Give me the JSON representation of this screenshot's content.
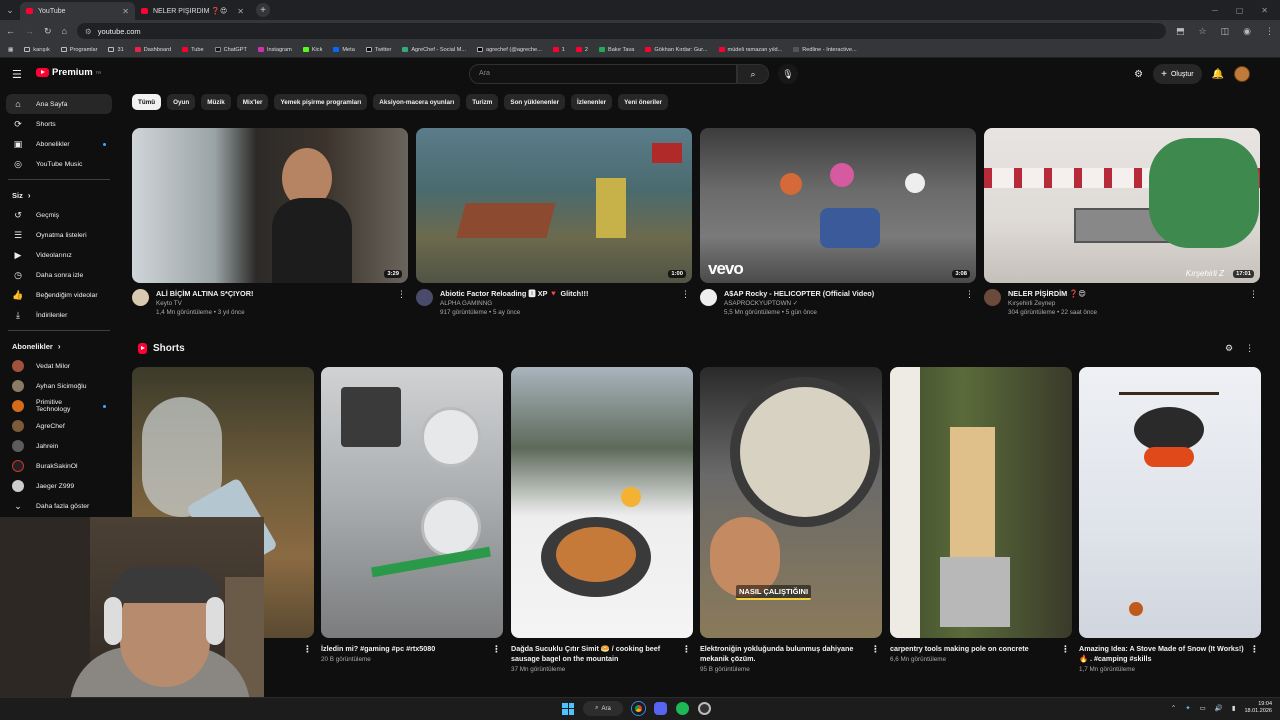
{
  "browser": {
    "tabs": [
      {
        "title": "YouTube",
        "active": true
      },
      {
        "title": "NELER PİŞİRDİM ❓😍 - YouTube",
        "active": false
      }
    ],
    "address": "youtube.com",
    "bookmarks": [
      "karışık",
      "Programlar",
      "31",
      "Dashboard",
      "Tube",
      "ChatGPT",
      "Instagram",
      "Kick",
      "Meta",
      "Twitter",
      "AgreChef - Social M...",
      "agrechef (@agreche...",
      "1",
      "2",
      "Bakır Tava",
      "Gökhan Kırdar: Gur...",
      "müdeli ramazan yıld...",
      "Redline - Interactive..."
    ]
  },
  "masthead": {
    "logo_text": "Premium",
    "logo_region": "TR",
    "search_placeholder": "Ara",
    "create_label": "Oluştur"
  },
  "sidebar": {
    "main": [
      {
        "label": "Ana Sayfa",
        "icon": "home-icon",
        "active": true
      },
      {
        "label": "Shorts",
        "icon": "shorts-icon"
      },
      {
        "label": "Abonelikler",
        "icon": "subscriptions-icon",
        "dot": true
      },
      {
        "label": "YouTube Music",
        "icon": "music-icon"
      }
    ],
    "you_heading": "Siz",
    "you": [
      {
        "label": "Geçmiş",
        "icon": "history-icon"
      },
      {
        "label": "Oynatma listeleri",
        "icon": "playlists-icon"
      },
      {
        "label": "Videolarınız",
        "icon": "your-videos-icon"
      },
      {
        "label": "Daha sonra izle",
        "icon": "watch-later-icon"
      },
      {
        "label": "Beğendiğim videolar",
        "icon": "liked-icon"
      },
      {
        "label": "İndirilenler",
        "icon": "downloads-icon"
      }
    ],
    "subs_heading": "Abonelikler",
    "subs": [
      {
        "label": "Vedat Milor",
        "color": "#a0523d"
      },
      {
        "label": "Ayhan Sicimoğlu",
        "color": "#8a7b64"
      },
      {
        "label": "Primitive Technology",
        "color": "#d46a1a",
        "dot": true
      },
      {
        "label": "AgreChef",
        "color": "#7c5a3a"
      },
      {
        "label": "Jahrein",
        "color": "#5c5c5c"
      },
      {
        "label": "BurakSakinOl",
        "color": "#222222"
      },
      {
        "label": "Jaeger Z999",
        "color": "#cccccc"
      }
    ],
    "more_label": "Daha fazla göster"
  },
  "chips": [
    "Tümü",
    "Oyun",
    "Müzik",
    "Mix'ler",
    "Yemek pişirme programları",
    "Aksiyon-macera oyunları",
    "Turizm",
    "Son yüklenenler",
    "İzlenenler",
    "Yeni öneriler"
  ],
  "videos": [
    {
      "title": "ALİ BİÇİM ALTINA S*ÇIYOR!",
      "channel": "Keyto TV",
      "stats": "1,4 Mn görüntüleme • 3 yıl önce",
      "duration": "3:29"
    },
    {
      "title": "Abiotic Factor Reloading 🆇 XP 🔻 Glitch!!!",
      "channel": "ALPHA GAMINNG",
      "stats": "917 görüntüleme • 5 ay önce",
      "duration": "1:00"
    },
    {
      "title": "A$AP Rocky - HELICOPTER (Official Video)",
      "channel": "ASAPROCKYUPTOWN ✓",
      "stats": "5,5 Mn görüntüleme • 5 gün önce",
      "duration": "3:08",
      "watermark": "vevo"
    },
    {
      "title": "NELER PİŞİRDİM ❓😍",
      "channel": "Kırşehirli Zeynep",
      "stats": "304 görüntüleme • 22 saat önce",
      "duration": "17:01",
      "watermark": "Kırşehirli Z"
    }
  ],
  "shorts": {
    "heading": "Shorts",
    "items": [
      {
        "title": "",
        "views": ""
      },
      {
        "title": "İzledin mi? #gaming #pc #rtx5080",
        "views": "20 B görüntüleme"
      },
      {
        "title": "Dağda Sucuklu Çıtır Simit 🥯 / cooking beef sausage bagel on the mountain",
        "views": "37 Mn görüntüleme"
      },
      {
        "title": "Elektroniğin yokluğunda bulunmuş dahiyane mekanik çözüm.",
        "views": "95 B görüntüleme",
        "caption": "NASIL ÇALIŞTIĞINI"
      },
      {
        "title": "carpentry tools making pole on concrete",
        "views": "6,6 Mn görüntüleme"
      },
      {
        "title": "Amazing Idea: A Stove Made of Snow (It Works!) 🔥 . #camping #skills",
        "views": "1,7 Mn görüntüleme"
      }
    ]
  },
  "taskbar": {
    "search_label": "Ara",
    "time": "19:04",
    "date": "18.01.2026"
  }
}
